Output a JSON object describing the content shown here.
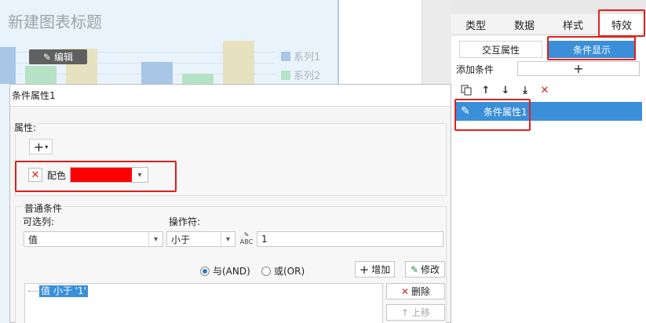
{
  "chart": {
    "title": "新建图表标题",
    "edit_label": "编辑",
    "legend": [
      {
        "name": "系列1",
        "color": "#a8c6e6"
      },
      {
        "name": "系列2",
        "color": "#b6e2c6"
      }
    ]
  },
  "right_panel": {
    "tabs": [
      {
        "label": "类型"
      },
      {
        "label": "数据"
      },
      {
        "label": "样式"
      },
      {
        "label": "特效"
      }
    ],
    "active_tab": "特效",
    "subtabs": [
      {
        "label": "交互属性"
      },
      {
        "label": "条件显示"
      }
    ],
    "active_subtab": "条件显示",
    "add_condition_label": "添加条件",
    "add_condition_symbol": "+",
    "toolbar_icons": [
      "copy-icon",
      "arrow-up-icon",
      "arrow-down-icon",
      "move-bottom-icon",
      "delete-icon"
    ],
    "condition_item": "条件属性1"
  },
  "dialog": {
    "title": "条件属性1",
    "properties": {
      "legend": "属性:",
      "add_symbol": "+",
      "color_label": "配色",
      "color_value": "#ff0000"
    },
    "conditions": {
      "legend": "普通条件",
      "column_label": "可选列:",
      "column_value": "值",
      "operator_label": "操作符:",
      "operator_value": "小于",
      "value": "1",
      "logic_and": "与(AND)",
      "logic_or": "或(OR)",
      "logic_selected": "and",
      "add_button": "增加",
      "modify_button": "修改",
      "delete_button": "删除",
      "up_button": "上移",
      "list_items": [
        "值 小于 '1'"
      ]
    }
  },
  "colors": {
    "accent": "#3b8fd8",
    "highlight_box": "#e0201a"
  }
}
